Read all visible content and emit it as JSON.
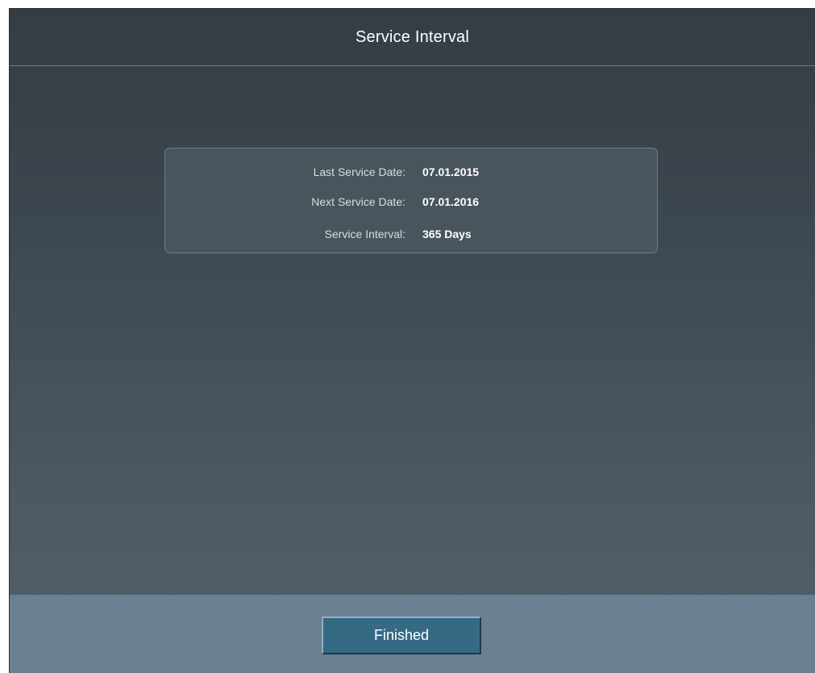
{
  "header": {
    "title": "Service Interval"
  },
  "service_info": [
    {
      "label": "Last Service Date:",
      "value": "07.01.2015"
    },
    {
      "label": "Next Service Date:",
      "value": "07.01.2016"
    },
    {
      "label": "Service Interval:",
      "value": "365 Days"
    }
  ],
  "footer": {
    "finished_label": "Finished"
  },
  "colors": {
    "background_top": "#353d44",
    "background_bottom": "#52616b",
    "panel": "#48555d",
    "footer": "#6a7f90",
    "button": "#356a85"
  }
}
